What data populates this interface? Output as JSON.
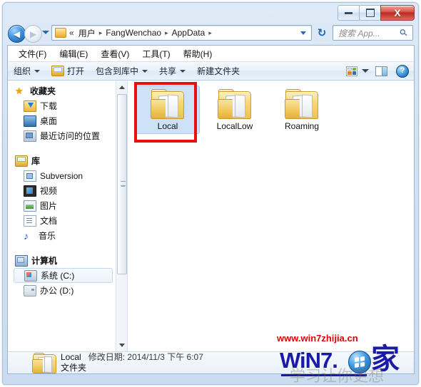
{
  "window": {
    "controls": {
      "minimize": "–",
      "maximize": "□",
      "close": "X"
    }
  },
  "address": {
    "back_glyph": "◀",
    "forward_glyph": "▶",
    "folder_icon": "folder-icon",
    "chevron": "«",
    "crumbs": [
      "用户",
      "FangWenchao",
      "AppData"
    ],
    "separator": "▸",
    "trailing_separator": "▸",
    "refresh_glyph": "↻"
  },
  "search": {
    "placeholder": "搜索 App...",
    "icon_glyph": "⚲"
  },
  "menubar": {
    "items": [
      {
        "label": "文件(F)"
      },
      {
        "label": "编辑(E)"
      },
      {
        "label": "查看(V)"
      },
      {
        "label": "工具(T)"
      },
      {
        "label": "帮助(H)"
      }
    ]
  },
  "toolbar": {
    "organize": "组织",
    "open": "打开",
    "include_in_library": "包含到库中",
    "share": "共享",
    "new_folder": "新建文件夹",
    "help_glyph": "?"
  },
  "sidebar": {
    "groups": [
      {
        "header": {
          "label": "收藏夹",
          "icon": "star-icon"
        },
        "items": [
          {
            "label": "下载",
            "icon": "download-icon"
          },
          {
            "label": "桌面",
            "icon": "desktop-icon"
          },
          {
            "label": "最近访问的位置",
            "icon": "recent-places-icon"
          }
        ]
      },
      {
        "header": {
          "label": "库",
          "icon": "library-icon"
        },
        "items": [
          {
            "label": "Subversion",
            "icon": "subversion-icon"
          },
          {
            "label": "视频",
            "icon": "video-icon"
          },
          {
            "label": "图片",
            "icon": "pictures-icon"
          },
          {
            "label": "文档",
            "icon": "documents-icon"
          },
          {
            "label": "音乐",
            "icon": "music-icon"
          }
        ]
      },
      {
        "header": {
          "label": "计算机",
          "icon": "computer-icon"
        },
        "items": [
          {
            "label": "系统 (C:)",
            "icon": "system-drive-icon",
            "selected": true
          },
          {
            "label": "办公 (D:)",
            "icon": "drive-icon"
          }
        ]
      }
    ]
  },
  "files": [
    {
      "name": "Local",
      "icon": "folder-icon",
      "selected": true,
      "annotated": true
    },
    {
      "name": "LocalLow",
      "icon": "folder-icon",
      "selected": false,
      "annotated": false
    },
    {
      "name": "Roaming",
      "icon": "folder-icon",
      "selected": false,
      "annotated": false
    }
  ],
  "status": {
    "name": "Local",
    "modified_label": "修改日期:",
    "modified_value": "2014/11/3 下午 6:07",
    "type": "文件夹"
  },
  "watermark": {
    "url": "www.win7zhijia.cn",
    "brand": "WiN7.",
    "brand_suffix": "家",
    "ghost": "学习让你更想"
  },
  "colors": {
    "accent": "#1259ab",
    "selection": "#cde2f7",
    "annotation": "#e81010",
    "watermark_url": "#e00000",
    "watermark_brand": "#1a1aa8"
  }
}
